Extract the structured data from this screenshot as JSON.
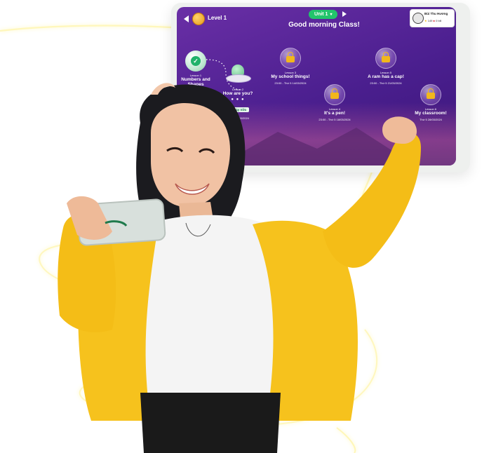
{
  "header": {
    "level_label": "Level 1",
    "unit_label": "Unit 1",
    "greeting": "Good morning Class!"
  },
  "user": {
    "name": "Bùi Thu Hương",
    "stars": "149",
    "gifts": "0 bill"
  },
  "lessons": [
    {
      "number": "Lesson 1",
      "title": "Numbers and Shapes",
      "date": "",
      "state": "done"
    },
    {
      "number": "Lesson 2",
      "title": "How are you?",
      "date": "Thứ 5 07/03/2024",
      "state": "current",
      "day_tag": "1 ngày nữa"
    },
    {
      "number": "Lesson 3",
      "title": "My school things!",
      "date": "23:00 - Thứ 5 14/03/2024",
      "state": "locked"
    },
    {
      "number": "Lesson 4",
      "title": "It's a pen!",
      "date": "23:00 - Thứ 5 18/03/2024",
      "state": "locked"
    },
    {
      "number": "Lesson 5",
      "title": "A ram has a cap!",
      "date": "23:00 - Thứ 5 21/03/2024",
      "state": "locked"
    },
    {
      "number": "Lesson 6",
      "title": "My classroom!",
      "date": "Thứ 5 28/03/2024",
      "state": "locked"
    }
  ],
  "colors": {
    "screen_purple": "#5a27a0",
    "unit_green": "#22c46b",
    "lock_gold": "#f2b71c",
    "jacket_yellow": "#f6c21d",
    "glow": "#fff6a8"
  }
}
